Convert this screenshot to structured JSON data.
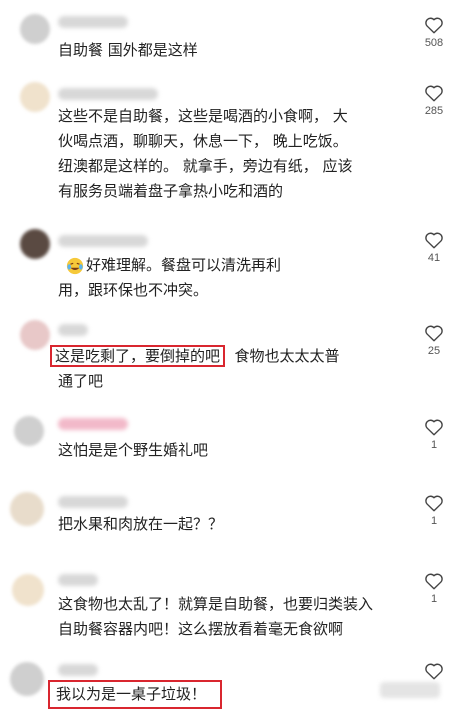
{
  "comments": [
    {
      "text": "自助餐 国外都是这样",
      "likes": "508"
    },
    {
      "text": "这些不是自助餐，这些是喝酒的小食啊， 大\n伙喝点酒，聊聊天，休息一下， 晚上吃饭。\n纽澳都是这样的。 就拿手，旁边有纸， 应该\n有服务员端着盘子拿热小吃和酒的",
      "likes": "285"
    },
    {
      "text_a": "好难理解。餐盘可以清洗再利",
      "text_b": "用，跟环保也不冲突。",
      "likes": "41"
    },
    {
      "text_highlight": "这是吃剩了，要倒掉的吧",
      "text_rest": "  食物也太太太普",
      "text_line2": "通了吧",
      "likes": "25"
    },
    {
      "text": "这怕是是个野生婚礼吧",
      "likes": "1"
    },
    {
      "text": "把水果和肉放在一起？？",
      "likes": "1"
    },
    {
      "text": "这食物也太乱了！就算是自助餐，也要归类装入\n自助餐容器内吧！这么摆放看着毫无食欲啊",
      "likes": "1"
    },
    {
      "text_highlight": "我以为是一桌子垃圾！",
      "likes": ""
    }
  ],
  "colors": {
    "highlight_border": "#d9262f",
    "text": "#222222",
    "icon": "#444444"
  },
  "icons": {
    "like": "heart-outline-icon",
    "emoji": "crying-laughing-emoji-icon"
  }
}
